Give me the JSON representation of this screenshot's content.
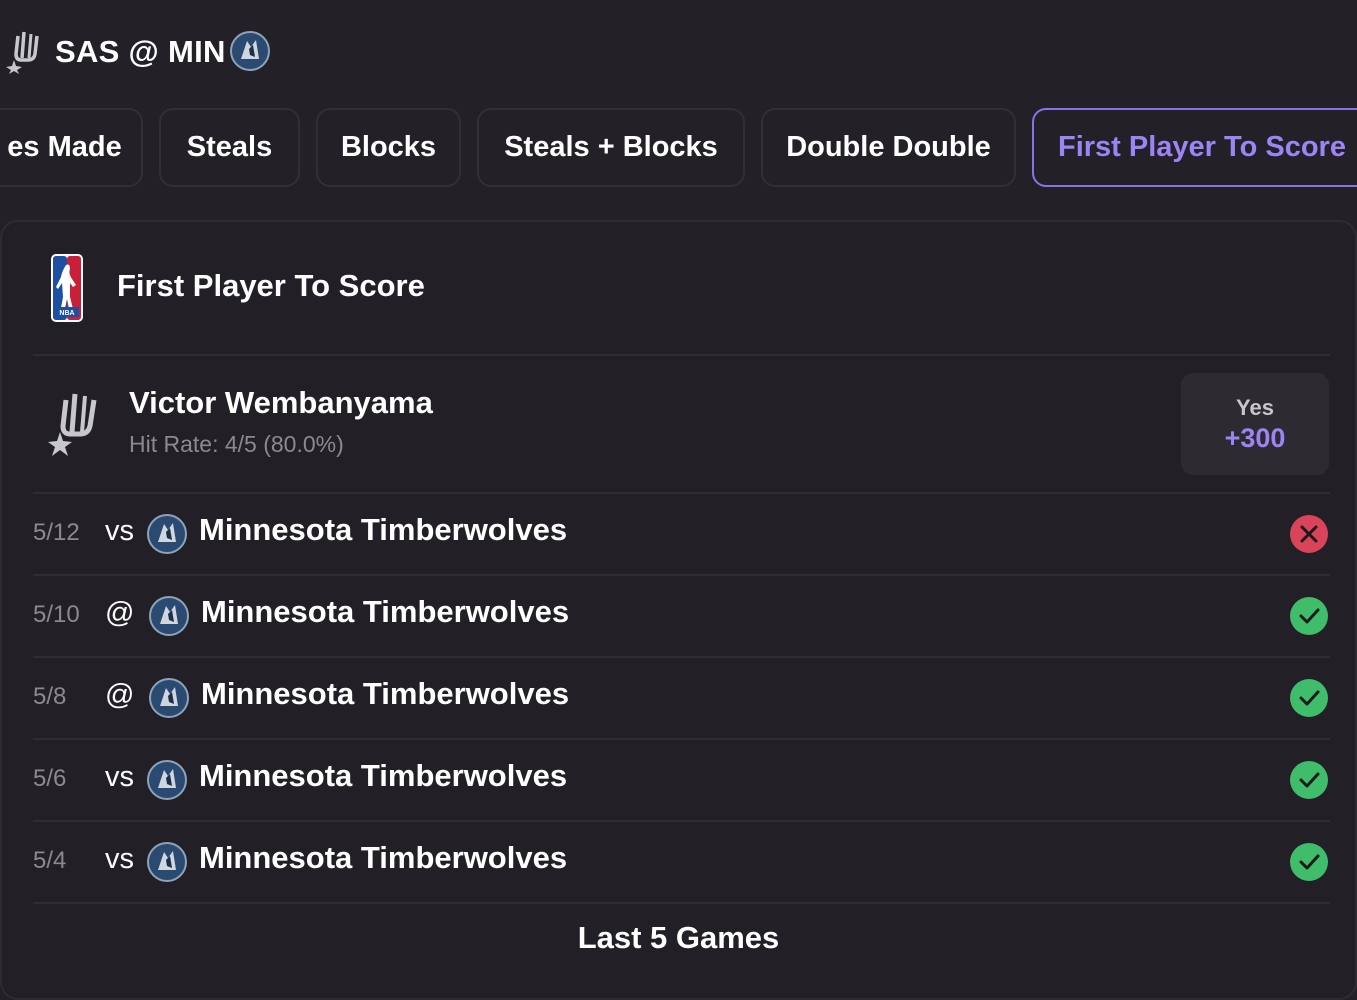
{
  "header": {
    "away_team_icon": "spurs-logo-icon",
    "matchup": "SAS @ MIN",
    "home_team_icon": "timberwolves-logo-icon"
  },
  "tabs": [
    {
      "label": "es Made",
      "active": false
    },
    {
      "label": "Steals",
      "active": false
    },
    {
      "label": "Blocks",
      "active": false
    },
    {
      "label": "Steals + Blocks",
      "active": false
    },
    {
      "label": "Double Double",
      "active": false
    },
    {
      "label": "First Player To Score",
      "active": true
    }
  ],
  "market": {
    "league_icon": "nba-logo-icon",
    "title": "First Player To Score"
  },
  "player": {
    "team_icon": "spurs-logo-icon",
    "name": "Victor Wembanyama",
    "hit_rate": "Hit Rate: 4/5 (80.0%)",
    "odds": {
      "label": "Yes",
      "price": "+300"
    }
  },
  "games": [
    {
      "date": "5/12",
      "location": "vs",
      "opponent": "Minnesota Timberwolves",
      "result": "miss"
    },
    {
      "date": "5/10",
      "location": "@",
      "opponent": "Minnesota Timberwolves",
      "result": "hit"
    },
    {
      "date": "5/8",
      "location": "@",
      "opponent": "Minnesota Timberwolves",
      "result": "hit"
    },
    {
      "date": "5/6",
      "location": "vs",
      "opponent": "Minnesota Timberwolves",
      "result": "hit"
    },
    {
      "date": "5/4",
      "location": "vs",
      "opponent": "Minnesota Timberwolves",
      "result": "hit"
    }
  ],
  "footer": {
    "label": "Last 5 Games"
  },
  "colors": {
    "background": "#232127",
    "accent": "#9d84f5",
    "hit": "#3fbd6b",
    "miss": "#d9445a",
    "muted_text": "#8b8990"
  }
}
